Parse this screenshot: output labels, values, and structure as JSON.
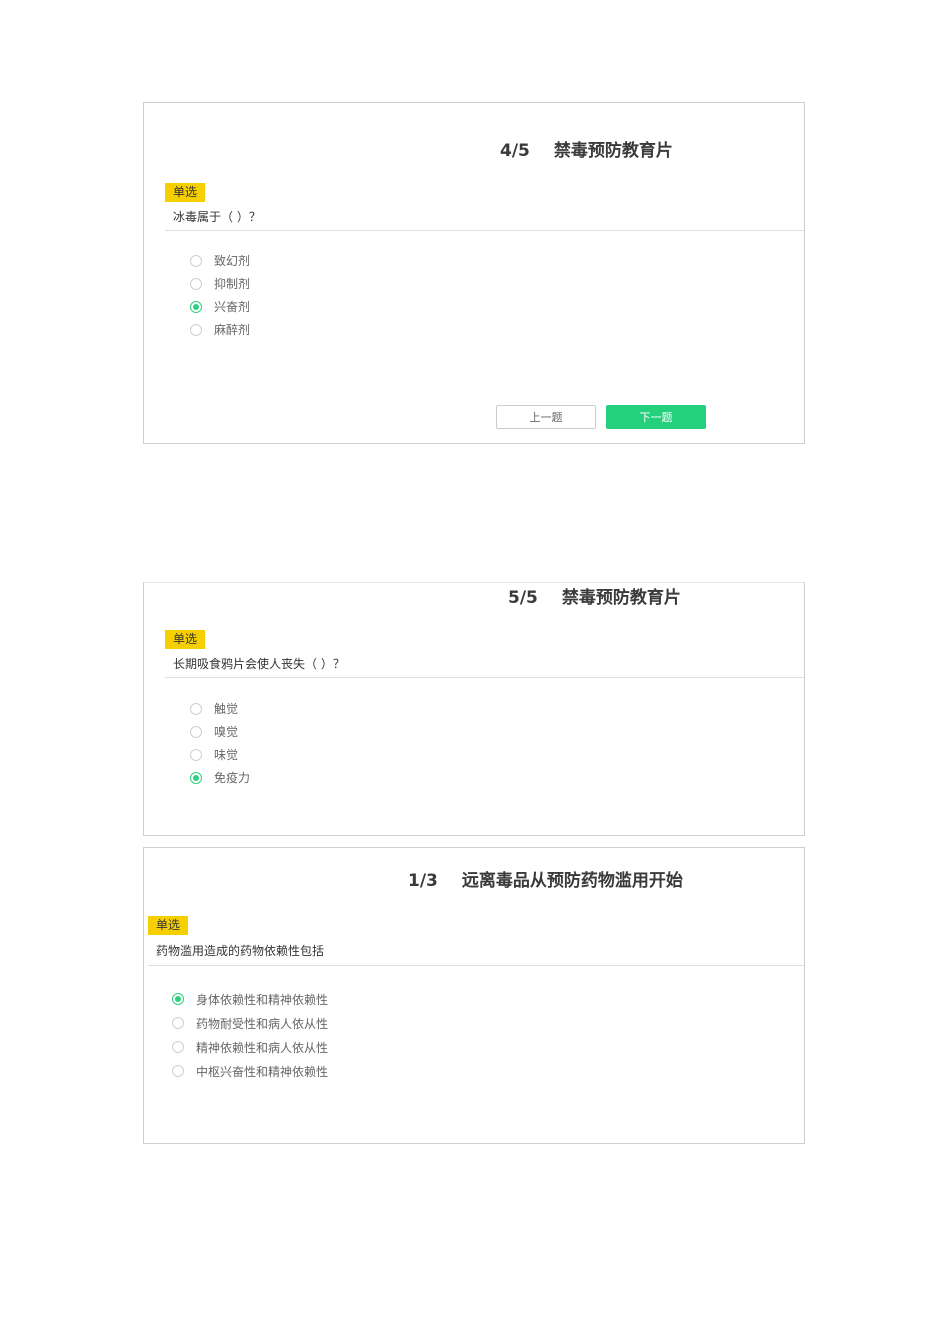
{
  "cards": [
    {
      "progress": "4/5",
      "title": "禁毒预防教育片",
      "badge": "单选",
      "question": "冰毒属于（ ）？",
      "options": [
        {
          "label": "致幻剂",
          "selected": false
        },
        {
          "label": "抑制剂",
          "selected": false
        },
        {
          "label": "兴奋剂",
          "selected": true
        },
        {
          "label": "麻醉剂",
          "selected": false
        }
      ],
      "prev_label": "上一题",
      "next_label": "下一题"
    },
    {
      "progress": "5/5",
      "title": "禁毒预防教育片",
      "badge": "单选",
      "question": "长期吸食鸦片会使人丧失（ ）？",
      "options": [
        {
          "label": "触觉",
          "selected": false
        },
        {
          "label": "嗅觉",
          "selected": false
        },
        {
          "label": "味觉",
          "selected": false
        },
        {
          "label": "免疫力",
          "selected": true
        }
      ]
    },
    {
      "progress": "1/3",
      "title": "远离毒品从预防药物滥用开始",
      "badge": "单选",
      "question": "药物滥用造成的药物依赖性包括",
      "options": [
        {
          "label": "身体依赖性和精神依赖性",
          "selected": true
        },
        {
          "label": "药物耐受性和病人依从性",
          "selected": false
        },
        {
          "label": "精神依赖性和病人依从性",
          "selected": false
        },
        {
          "label": "中枢兴奋性和精神依赖性",
          "selected": false
        }
      ]
    }
  ],
  "colors": {
    "accent_green": "#25d07c",
    "badge_yellow": "#f5cf00"
  }
}
